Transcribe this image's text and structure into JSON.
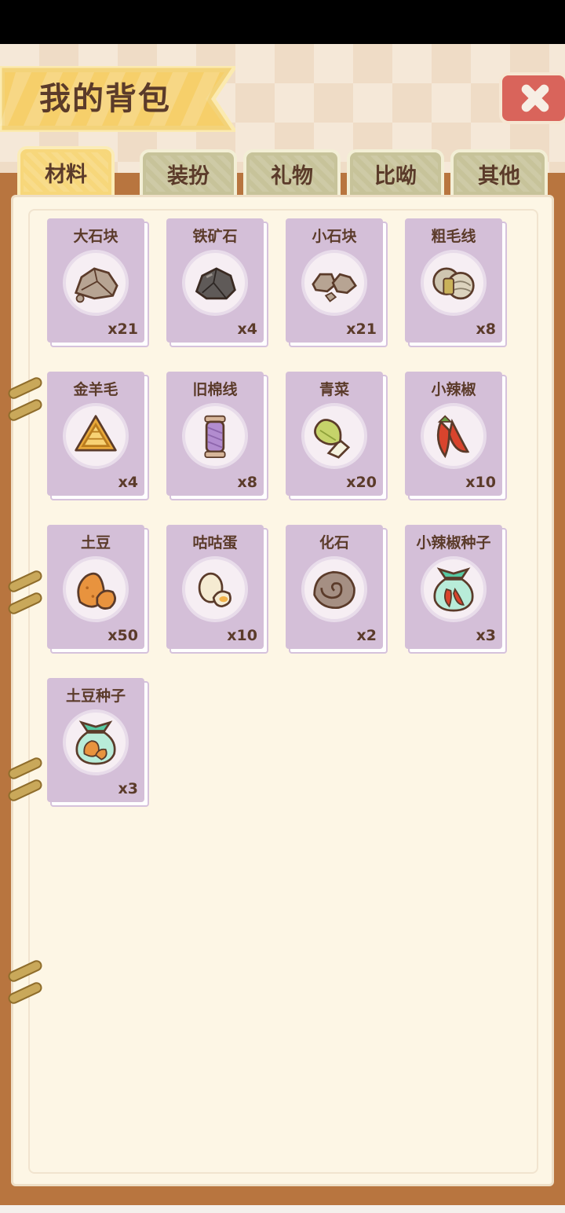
{
  "header": {
    "title": "我的背包"
  },
  "tabs": [
    {
      "label": "材料",
      "active": true
    },
    {
      "label": "装扮",
      "active": false
    },
    {
      "label": "礼物",
      "active": false
    },
    {
      "label": "比呦",
      "active": false
    },
    {
      "label": "其他",
      "active": false
    }
  ],
  "items": [
    {
      "name": "大石块",
      "count": "x21",
      "icon": "big-rock-icon"
    },
    {
      "name": "铁矿石",
      "count": "x4",
      "icon": "iron-ore-icon"
    },
    {
      "name": "小石块",
      "count": "x21",
      "icon": "small-rocks-icon"
    },
    {
      "name": "粗毛线",
      "count": "x8",
      "icon": "coarse-yarn-icon"
    },
    {
      "name": "金羊毛",
      "count": "x4",
      "icon": "golden-wool-icon"
    },
    {
      "name": "旧棉线",
      "count": "x8",
      "icon": "cotton-spool-icon"
    },
    {
      "name": "青菜",
      "count": "x20",
      "icon": "bok-choy-icon"
    },
    {
      "name": "小辣椒",
      "count": "x10",
      "icon": "chili-pepper-icon"
    },
    {
      "name": "土豆",
      "count": "x50",
      "icon": "potato-icon"
    },
    {
      "name": "咕咕蛋",
      "count": "x10",
      "icon": "egg-icon"
    },
    {
      "name": "化石",
      "count": "x2",
      "icon": "fossil-icon"
    },
    {
      "name": "小辣椒种子",
      "count": "x3",
      "icon": "chili-seed-bag-icon"
    },
    {
      "name": "土豆种子",
      "count": "x3",
      "icon": "potato-seed-bag-icon"
    }
  ],
  "colors": {
    "card": "#d4bfd8",
    "activeTab": "#f7d77b",
    "inactiveTab": "#c7c39a",
    "board": "#b8753f",
    "paper": "#fdf6e5",
    "text": "#5b3b2a",
    "closeButton": "#d9645b"
  }
}
